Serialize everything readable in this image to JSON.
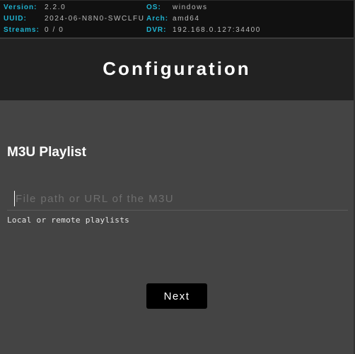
{
  "info": {
    "left": [
      {
        "label": "Version:",
        "value": "2.2.0"
      },
      {
        "label": "UUID:",
        "value": "2024-06-N8N0-SWCLFU"
      },
      {
        "label": "Streams:",
        "value": "0 / 0"
      }
    ],
    "right": [
      {
        "label": "OS:",
        "value": "windows"
      },
      {
        "label": "Arch:",
        "value": "amd64"
      },
      {
        "label": "DVR:",
        "value": "192.168.0.127:34400"
      }
    ]
  },
  "header": {
    "title": "Configuration"
  },
  "form": {
    "section_title": "M3U Playlist",
    "input_value": "",
    "input_placeholder": "File path or URL of the M3U",
    "helper_text": "Local or remote playlists",
    "next_label": "Next"
  },
  "colors": {
    "info_label": "#1fb4d2",
    "info_value": "#bbbbbb",
    "info_bg": "#111111",
    "header_bg": "#222222",
    "body_bg": "#444444",
    "button_bg": "#000000"
  }
}
